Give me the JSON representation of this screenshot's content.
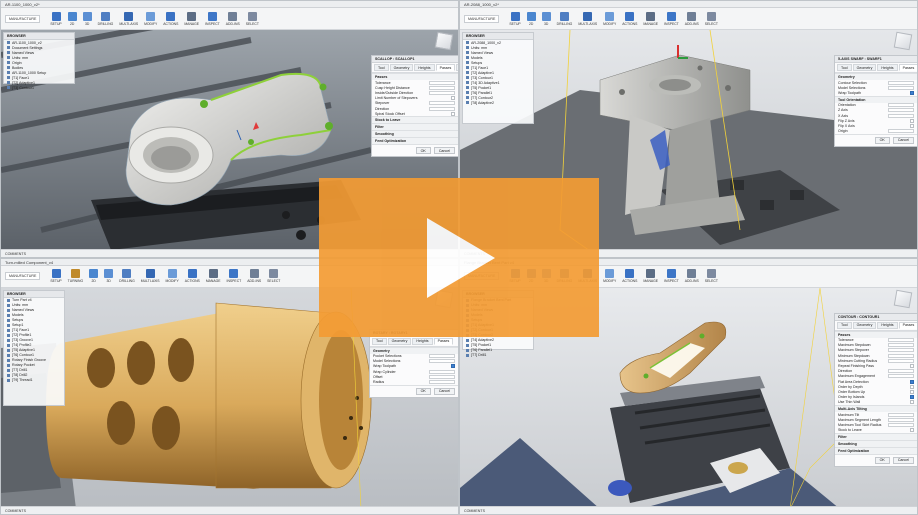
{
  "quadrants": [
    {
      "id": "q1",
      "window_title": "AR-1100_1000_v2*",
      "workspace": "MANUFACTURE",
      "toolbar": [
        "SETUP",
        "2D",
        "3D",
        "DRILLING",
        "MULTI-AXIS",
        "MODIFY",
        "ACTIONS",
        "MANAGE",
        "INSPECT",
        "ADD-INS",
        "SELECT"
      ],
      "toolbar_colors": [
        "#3a72c4",
        "#4a86cf",
        "#5b8fd3",
        "#4f7ec2",
        "#3568b3",
        "#6b9bd8",
        "#3a72c4",
        "#5c6d85",
        "#3d76c7",
        "#6f7f96",
        "#7d8aa0"
      ],
      "browser_title": "BROWSER",
      "browser_rows": [
        "AR-1100_1000_v2",
        "Document Settings",
        "Named Views",
        "Units: mm",
        "Origin",
        "Bodies",
        "AR-1100_1000 Setup",
        "[T1] Face1",
        "[T2] Adaptive1",
        "[T3] Contour1"
      ],
      "panel": {
        "title": "SCALLOP : SCALLOP1",
        "tabs": [
          "Tool",
          "Geometry",
          "Heights",
          "Passes",
          "Linking"
        ],
        "sections": [
          {
            "name": "Passes",
            "rows": [
              {
                "label": "Tolerance",
                "type": "value"
              },
              {
                "label": "Cusp Height Distance",
                "type": "value"
              },
              {
                "label": "Inside/Outside Direction",
                "type": "value"
              },
              {
                "label": "Limit Number of Stepovers",
                "type": "check",
                "on": false
              },
              {
                "label": "Stepover",
                "type": "value"
              },
              {
                "label": "Direction",
                "type": "value"
              },
              {
                "label": "Spiral Stock Offset",
                "type": "check",
                "on": false
              }
            ]
          },
          {
            "name": "Stock to Leave",
            "rows": []
          },
          {
            "name": "Filter",
            "rows": []
          },
          {
            "name": "Smoothing",
            "rows": []
          },
          {
            "name": "Feed Optimization",
            "rows": []
          }
        ],
        "ok": "OK",
        "cancel": "Cancel"
      },
      "status": "COMMENTS"
    },
    {
      "id": "q2",
      "window_title": "AR-2088_1000_v2*",
      "workspace": "MANUFACTURE",
      "toolbar": [
        "SETUP",
        "2D",
        "3D",
        "DRILLING",
        "MULTI-AXIS",
        "MODIFY",
        "ACTIONS",
        "MANAGE",
        "INSPECT",
        "ADD-INS",
        "SELECT"
      ],
      "toolbar_colors": [
        "#3a72c4",
        "#4a86cf",
        "#5b8fd3",
        "#4f7ec2",
        "#3568b3",
        "#6b9bd8",
        "#3a72c4",
        "#5c6d85",
        "#3d76c7",
        "#6f7f96",
        "#7d8aa0"
      ],
      "browser_title": "BROWSER",
      "browser_rows": [
        "AR-2088_1000_v2",
        "Units: mm",
        "Named Views",
        "Models",
        "Setups",
        "[T1] Face1",
        "[T2] Adaptive1",
        "[T3] Contour1",
        "[T4] 3D Adaptive1",
        "[T5] Pocket1",
        "[T6] Parallel1",
        "[T7] Contour2",
        "[T8] Adaptive2"
      ],
      "panel": {
        "title": "5-AXIS SWARF : SWARF1",
        "tabs": [
          "Tool",
          "Geometry",
          "Heights",
          "Passes",
          "Linking"
        ],
        "sections": [
          {
            "name": "Geometry",
            "rows": [
              {
                "label": "Contour Selection",
                "type": "value"
              },
              {
                "label": "Model Selections",
                "type": "value"
              },
              {
                "label": "Wrap Toolpath",
                "type": "check",
                "on": true
              }
            ]
          },
          {
            "name": "Tool Orientation",
            "rows": [
              {
                "label": "Orientation",
                "type": "value"
              },
              {
                "label": "Z Axis",
                "type": "value"
              },
              {
                "label": "X Axis",
                "type": "value"
              },
              {
                "label": "Flip Z Axis",
                "type": "check",
                "on": false
              },
              {
                "label": "Flip X Axis",
                "type": "check",
                "on": false
              },
              {
                "label": "Origin",
                "type": "value"
              }
            ]
          }
        ],
        "ok": "OK",
        "cancel": "Cancel"
      },
      "status": "COMMENTS"
    },
    {
      "id": "q3",
      "window_title": "Turn-milled Component_v4",
      "workspace": "MANUFACTURE",
      "toolbar": [
        "SETUP",
        "TURNING",
        "2D",
        "3D",
        "DRILLING",
        "MULTI-AXIS",
        "MODIFY",
        "ACTIONS",
        "MANAGE",
        "INSPECT",
        "ADD-INS",
        "SELECT"
      ],
      "toolbar_colors": [
        "#3a72c4",
        "#c08a2a",
        "#4a86cf",
        "#5b8fd3",
        "#4f7ec2",
        "#3568b3",
        "#6b9bd8",
        "#3a72c4",
        "#5c6d85",
        "#3d76c7",
        "#6f7f96",
        "#7d8aa0"
      ],
      "browser_title": "BROWSER",
      "browser_rows": [
        "Turn Part v4",
        "Units: mm",
        "Named Views",
        "Models",
        "Setups",
        "Setup1",
        "[T1] Face1",
        "[T2] Profile1",
        "[T3] Groove1",
        "[T4] Profile2",
        "[T5] Adaptive1",
        "[T6] Contour1",
        "Rotary Finish Groove",
        "Rotary Pocket",
        "[T7] Drill1",
        "[T8] Drill2",
        "[T9] Thread1"
      ],
      "panel": {
        "title": "ROTARY : ROTARY1",
        "tabs": [
          "Tool",
          "Geometry",
          "Heights",
          "Passes"
        ],
        "sections": [
          {
            "name": "Geometry",
            "rows": [
              {
                "label": "Pocket Selections",
                "type": "value"
              },
              {
                "label": "Model Selections",
                "type": "value"
              },
              {
                "label": "Wrap Toolpath",
                "type": "check",
                "on": true
              },
              {
                "label": "Wrap Cylinder",
                "type": "value"
              },
              {
                "label": "Offset",
                "type": "value"
              },
              {
                "label": "Radius",
                "type": "value"
              }
            ]
          }
        ],
        "ok": "OK",
        "cancel": "Cancel"
      },
      "status": "COMMENTS"
    },
    {
      "id": "q4",
      "window_title": "Flange Bracket Bent Part v4",
      "workspace": "MANUFACTURE",
      "toolbar": [
        "SETUP",
        "2D",
        "3D",
        "DRILLING",
        "MULTI-AXIS",
        "MODIFY",
        "ACTIONS",
        "MANAGE",
        "INSPECT",
        "ADD-INS",
        "SELECT"
      ],
      "toolbar_colors": [
        "#3a72c4",
        "#4a86cf",
        "#5b8fd3",
        "#4f7ec2",
        "#3568b3",
        "#6b9bd8",
        "#3a72c4",
        "#5c6d85",
        "#3d76c7",
        "#6f7f96",
        "#7d8aa0"
      ],
      "browser_title": "BROWSER",
      "browser_rows": [
        "Flange Bracket Bent Part",
        "Units: mm",
        "Named Views",
        "Models",
        "Setups",
        "[T1] Adaptive1",
        "[T2] Contour1",
        "[T3] Contour2",
        "[T4] Adaptive2",
        "[T5] Pocket1",
        "[T6] Parallel1",
        "[T7] Drill1"
      ],
      "panel": {
        "title": "CONTOUR : CONTOUR1",
        "tabs": [
          "Tool",
          "Geometry",
          "Heights",
          "Passes",
          "Linking"
        ],
        "sections": [
          {
            "name": "Passes",
            "rows": [
              {
                "label": "Tolerance",
                "type": "value"
              },
              {
                "label": "Maximum Stepdown",
                "type": "value"
              },
              {
                "label": "Maximum Stepover",
                "type": "value"
              },
              {
                "label": "Minimum Stepdown",
                "type": "value"
              },
              {
                "label": "Minimum Cutting Radius",
                "type": "value"
              },
              {
                "label": "Repeat Finishing Pass",
                "type": "check",
                "on": false
              },
              {
                "label": "Direction",
                "type": "value"
              },
              {
                "label": "Maximum Engagement",
                "type": "value"
              },
              {
                "label": "Flat Area Detection",
                "type": "check",
                "on": true
              },
              {
                "label": "Order by Depth",
                "type": "check",
                "on": false
              },
              {
                "label": "Order Bottom Up",
                "type": "check",
                "on": false
              },
              {
                "label": "Order by Islands",
                "type": "check",
                "on": true
              },
              {
                "label": "Use Thin Wall",
                "type": "check",
                "on": false
              }
            ]
          },
          {
            "name": "Multi-Axis Tilting",
            "rows": [
              {
                "label": "Maximum Tilt",
                "type": "value"
              },
              {
                "label": "Maximum Segment Length",
                "type": "value"
              },
              {
                "label": "Maximum Tool Skirt Radius",
                "type": "value"
              },
              {
                "label": "Stock to Leave",
                "type": "check",
                "on": false
              }
            ]
          },
          {
            "name": "Filter",
            "rows": []
          },
          {
            "name": "Smoothing",
            "rows": []
          },
          {
            "name": "Feed Optimization",
            "rows": []
          }
        ],
        "ok": "OK",
        "cancel": "Cancel"
      },
      "status": "COMMENTS"
    }
  ],
  "play_button": {
    "label": "play-video",
    "color": "#f39b33"
  }
}
